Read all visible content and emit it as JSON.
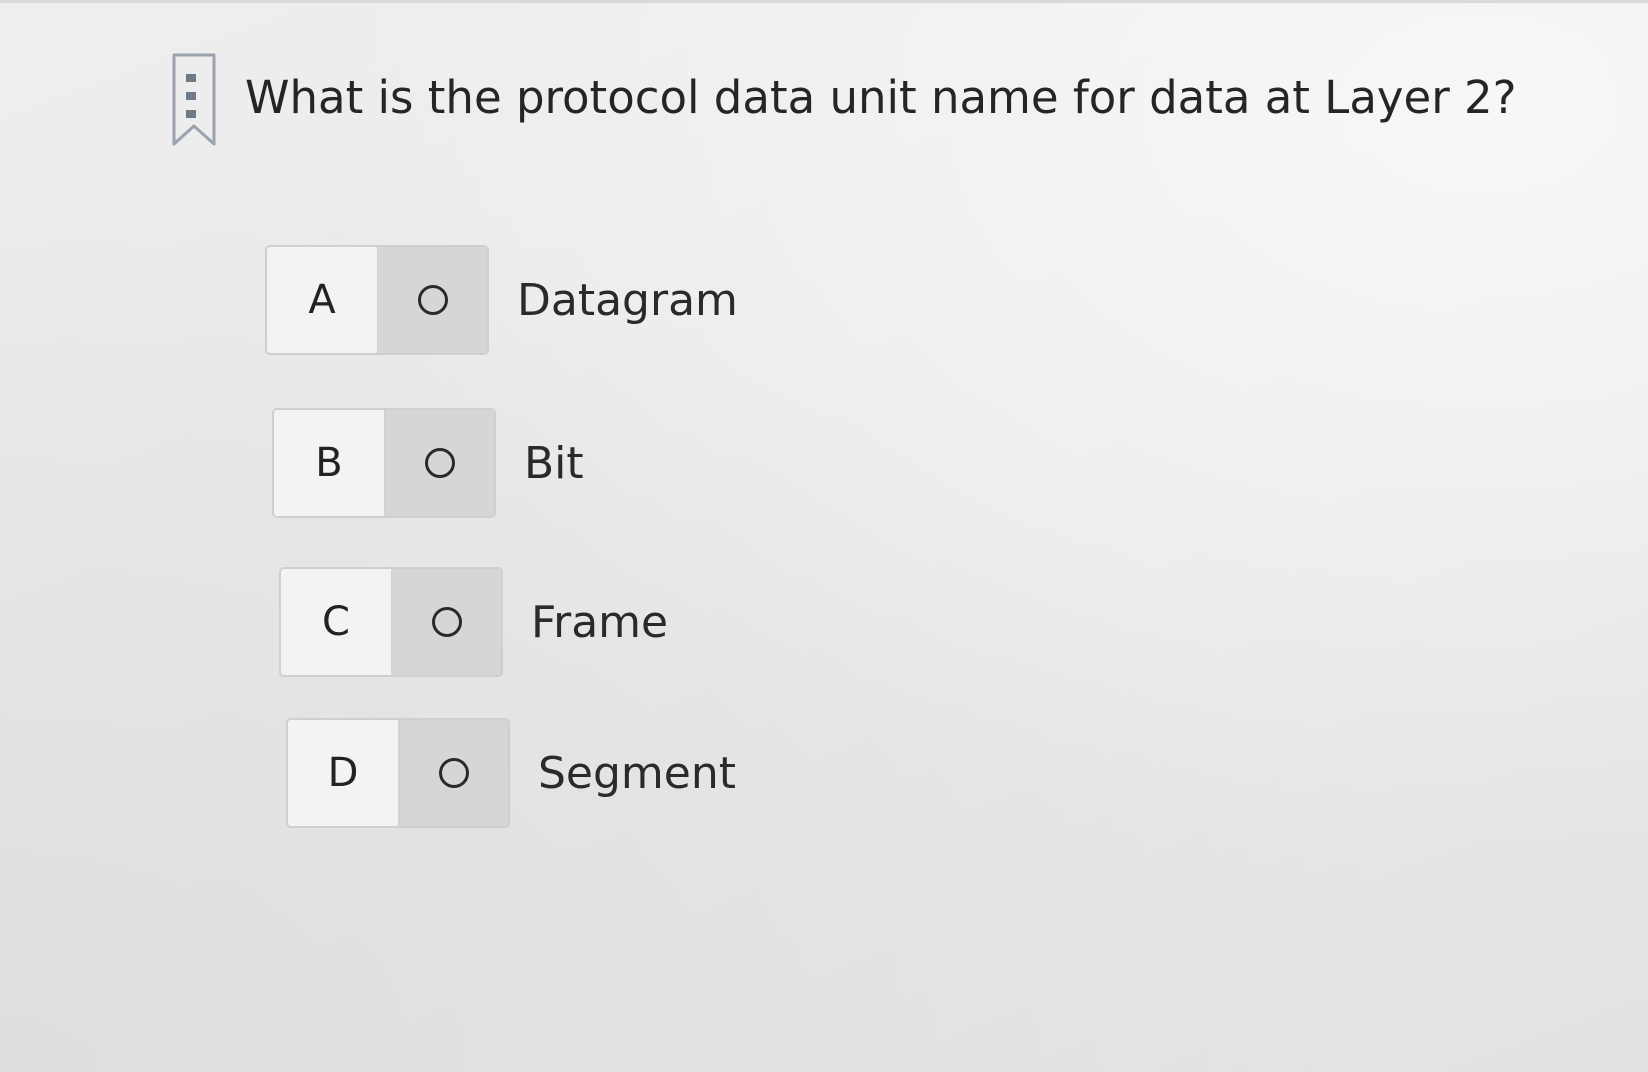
{
  "question": {
    "text": "What is the protocol data unit name for data at Layer 2?",
    "bookmark_icon": "bookmark-icon"
  },
  "options": [
    {
      "letter": "A",
      "label": "Datagram",
      "selected": false
    },
    {
      "letter": "B",
      "label": "Bit",
      "selected": false
    },
    {
      "letter": "C",
      "label": "Frame",
      "selected": false
    },
    {
      "letter": "D",
      "label": "Segment",
      "selected": false
    }
  ]
}
